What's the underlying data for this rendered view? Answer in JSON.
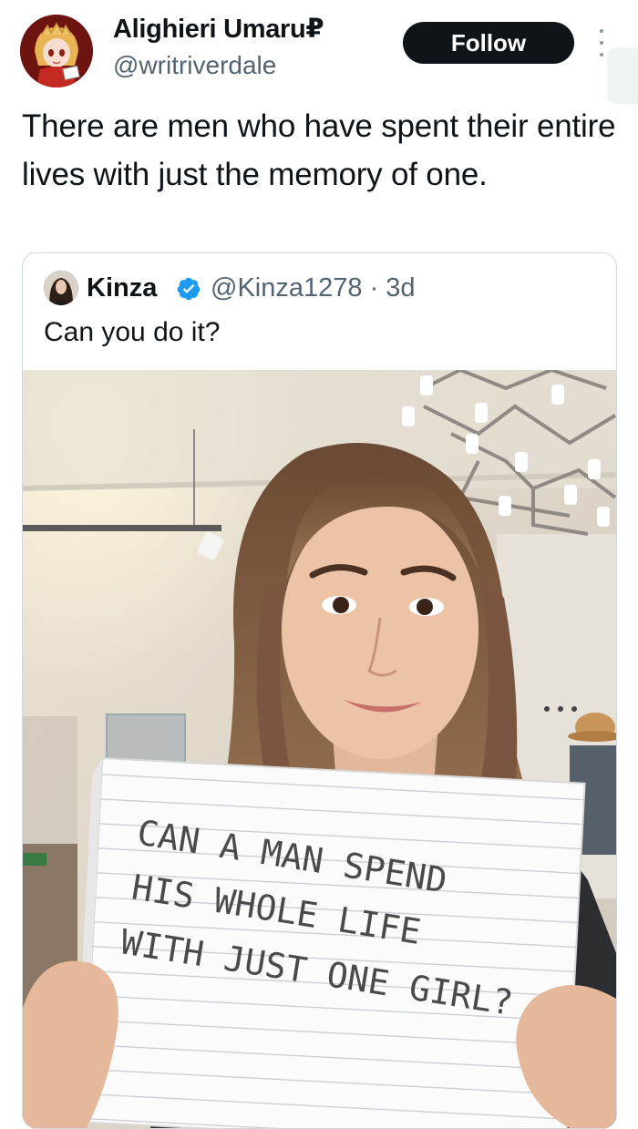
{
  "author": {
    "name": "Alighieri Umaru₽",
    "handle": "@writriverdale",
    "avatar_icon": "anime-avatar-icon"
  },
  "follow_label": "Follow",
  "more_icon": "more-options-icon",
  "tweet": {
    "text": "There are men who have spent their entire lives with just the memory of one."
  },
  "quoted_tweet": {
    "name": "Kinza",
    "handle": "@Kinza1278",
    "time": "· 3d",
    "text": "Can you do it?",
    "verified_icon": "verified-badge-icon",
    "image": {
      "sign_lines": [
        "CAN A MAN SPEND",
        "HIS WHOLE LIFE",
        "WITH JUST ONE GIRL?"
      ]
    }
  },
  "colors": {
    "text": "#0f1419",
    "secondary": "#536471",
    "verified": "#1d9bf0",
    "follow_bg": "#0f1419",
    "border": "#cfd9de"
  }
}
